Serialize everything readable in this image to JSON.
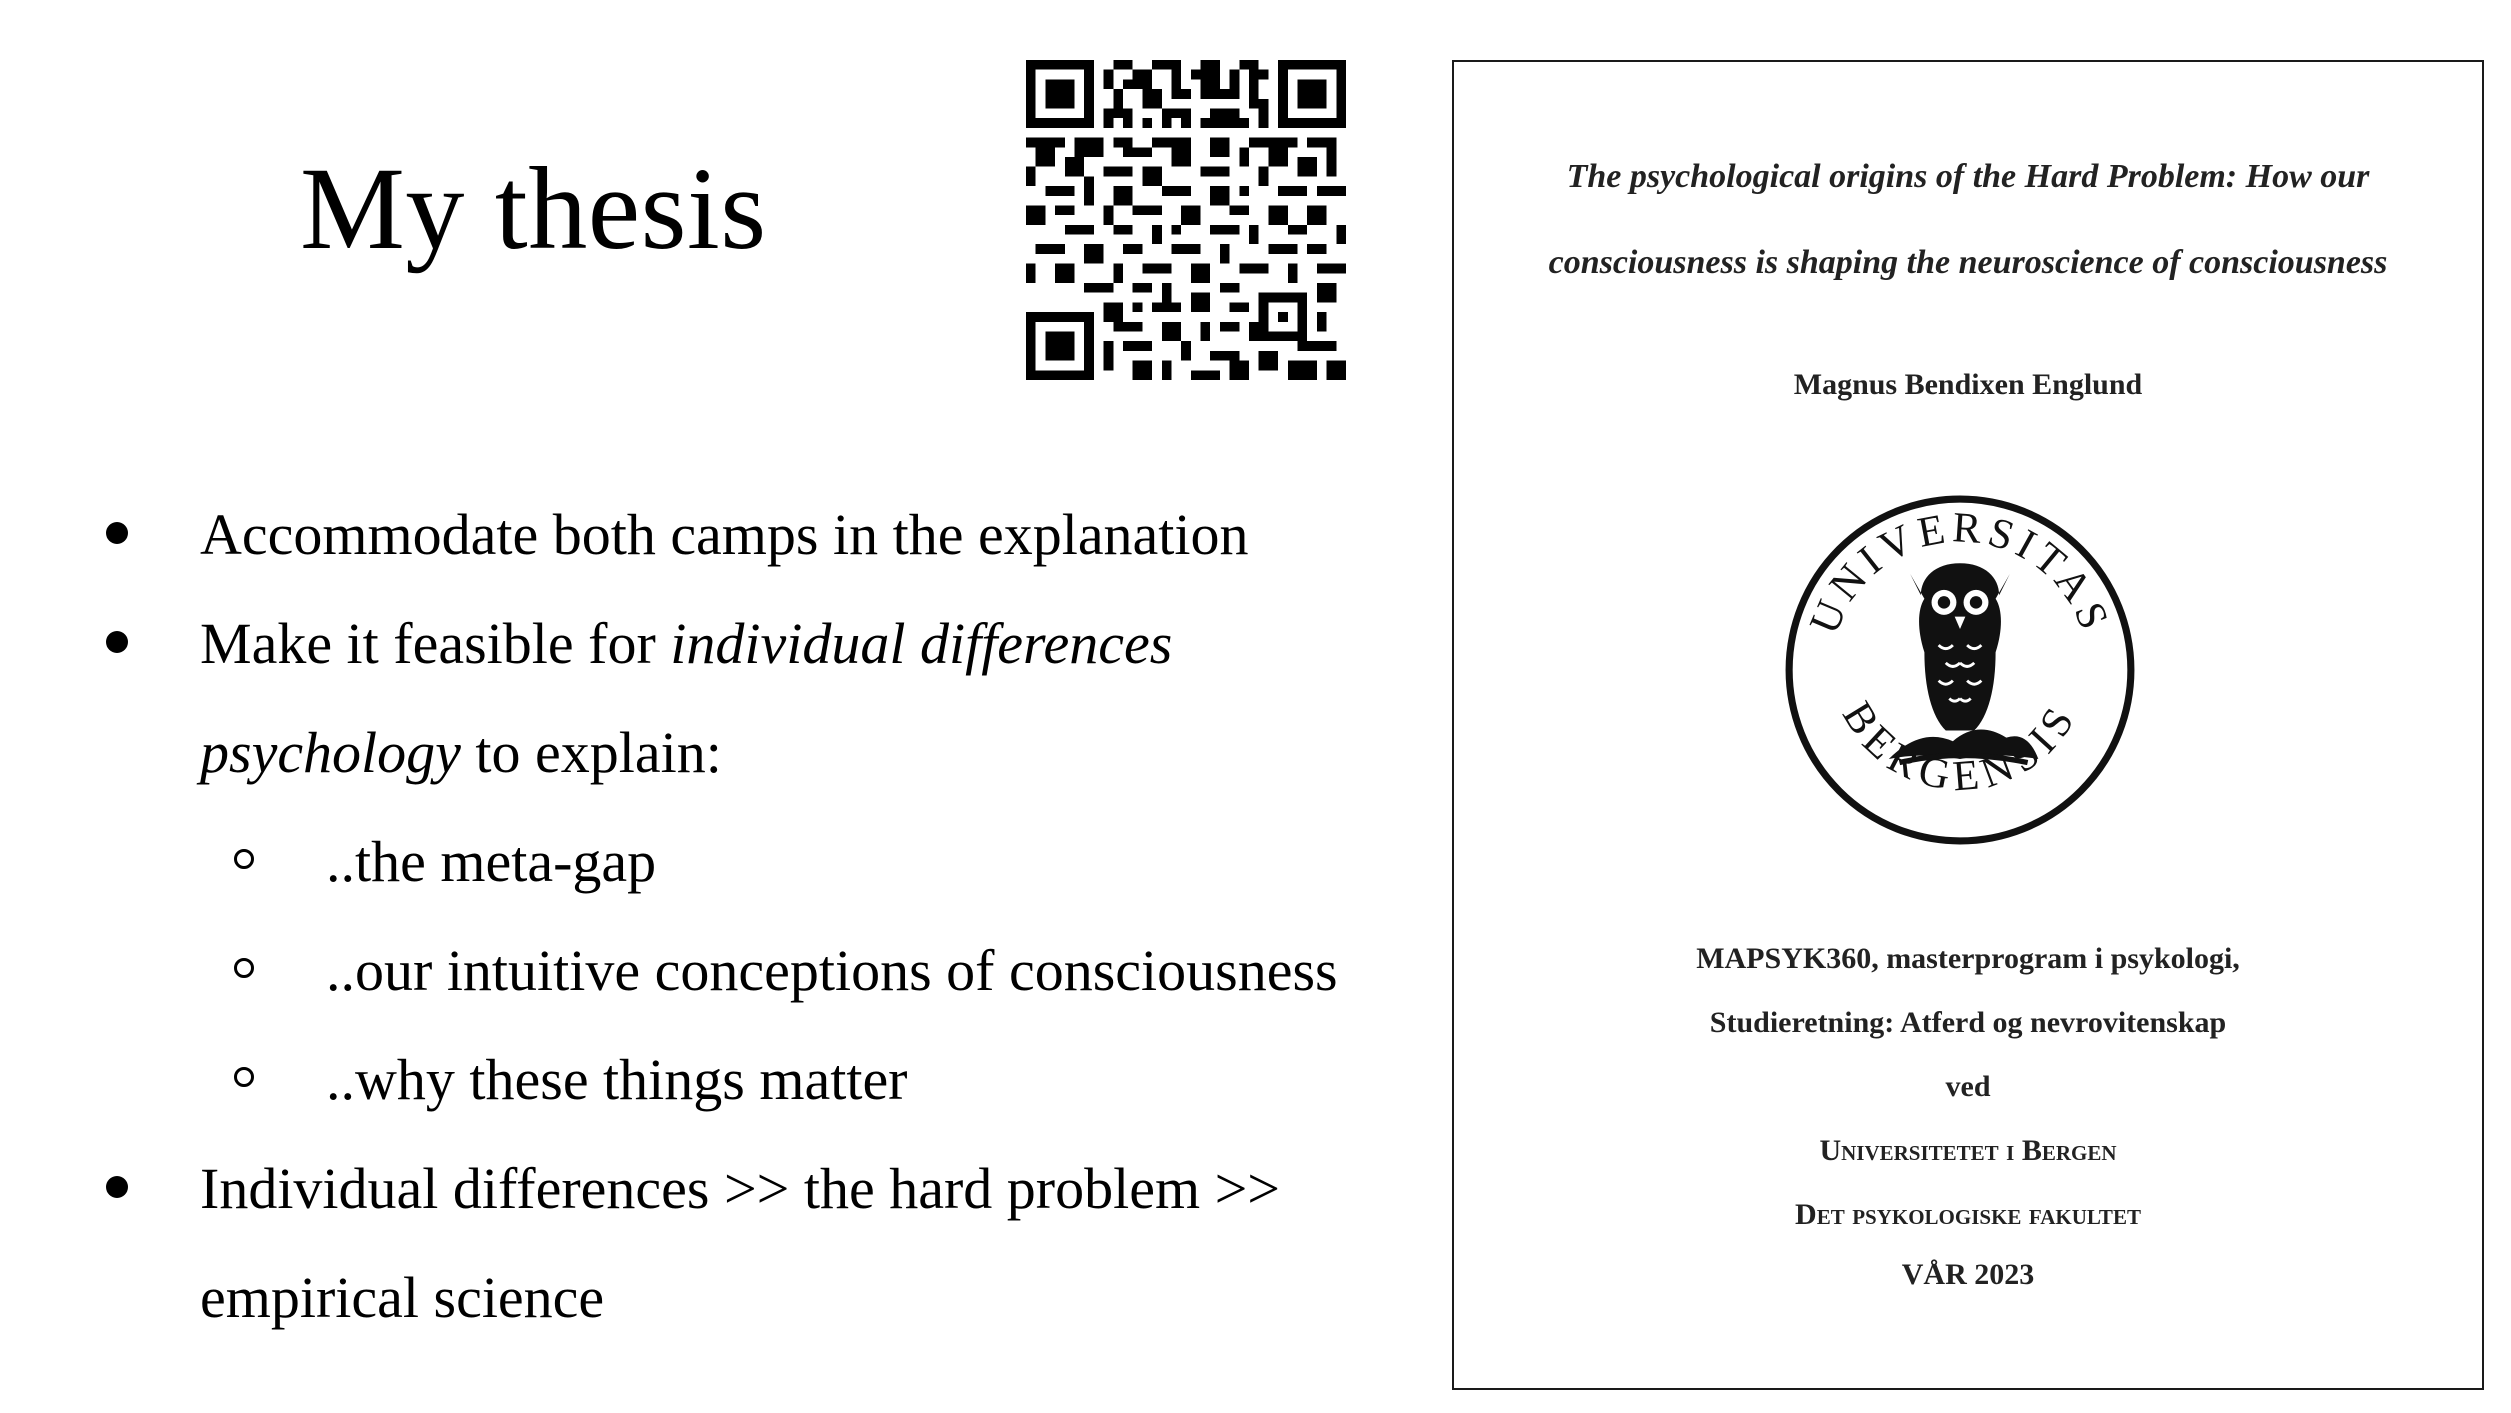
{
  "slide": {
    "title": "My thesis",
    "bullets": [
      {
        "level": 1,
        "text": "Accommodate both camps in the explanation"
      },
      {
        "level": 1,
        "parts": [
          "Make it feasible for ",
          "individual differences",
          "psychology",
          " to explain:"
        ]
      },
      {
        "level": 2,
        "text": "..the meta-gap"
      },
      {
        "level": 2,
        "text": "..our intuitive conceptions of consciousness"
      },
      {
        "level": 2,
        "text": "..why these things matter"
      },
      {
        "level": 1,
        "lines": [
          "Individual differences >> the hard problem >>",
          "empirical science"
        ]
      }
    ]
  },
  "qr_code": {
    "icon": "qr-code-icon"
  },
  "document": {
    "title_line1": "The psychological origins of the Hard Problem: How our",
    "title_line2": "consciousness is shaping the neuroscience of consciousness",
    "author": "Magnus Bendixen Englund",
    "seal": {
      "icon": "university-owl-seal-icon",
      "text": "UNIVERSITAS BERGENSIS"
    },
    "program": "MAPSYK360, masterprogram i psykologi,",
    "specialization": "Studieretning: Atferd og nevrovitenskap",
    "ved": "ved",
    "university": "Universitetet i Bergen",
    "faculty": "Det psykologiske fakultet",
    "term": "VÅR 2023"
  }
}
